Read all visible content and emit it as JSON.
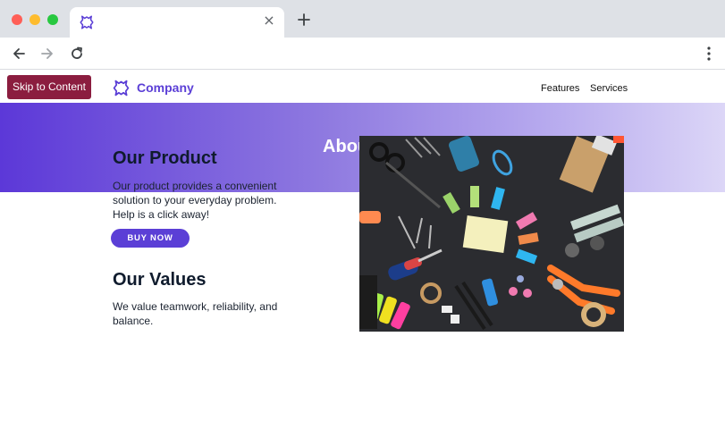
{
  "browser": {
    "tab_close_glyph": "×"
  },
  "page": {
    "skip_link": "Skip to Content",
    "brand_name": "Company",
    "nav": [
      "Features",
      "Services"
    ],
    "hero_title": "About Us",
    "product": {
      "title": "Our Product",
      "text": "Our product provides a convenient solution to your everyday problem. Help is a click away!",
      "button": "BUY NOW"
    },
    "values": {
      "title": "Our Values",
      "text": "We value teamwork, reliability, and balance."
    }
  },
  "colors": {
    "accent": "#5b3fd6",
    "skip_link_bg": "#8b1d3f"
  },
  "icons": [
    "company-logo-icon",
    "back-arrow-icon",
    "forward-arrow-icon",
    "reload-icon",
    "plus-icon",
    "kebab-menu-icon",
    "close-icon"
  ]
}
